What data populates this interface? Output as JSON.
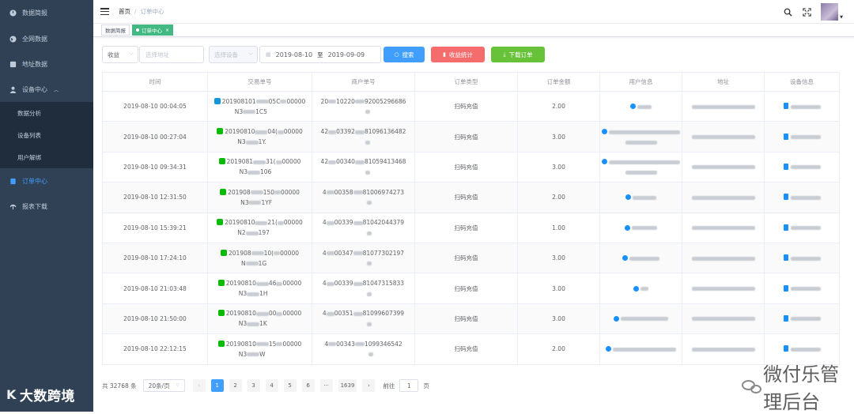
{
  "sidebar": {
    "items": [
      {
        "label": "数据简报",
        "icon": "dashboard-icon"
      },
      {
        "label": "全网数据",
        "icon": "globe-icon"
      },
      {
        "label": "地址数据",
        "icon": "location-icon"
      },
      {
        "label": "设备中心",
        "icon": "user-group-icon"
      },
      {
        "label": "订单中心",
        "icon": "order-icon"
      },
      {
        "label": "报表下载",
        "icon": "download-icon"
      }
    ],
    "sub_items": [
      "数据分析",
      "设备列表",
      "用户解绑"
    ],
    "active_color": "#409eff",
    "background": "#304156"
  },
  "watermark_left": {
    "logo": "K",
    "text": "大数跨境"
  },
  "header": {
    "breadcrumb_home": "首页",
    "breadcrumb_separator": "/",
    "breadcrumb_current": "订单中心"
  },
  "tags": {
    "items": [
      "数据简报",
      "订单中心"
    ],
    "close": "×",
    "active_color": "#42b983"
  },
  "filters": {
    "type_value": "收益",
    "address_placeholder": "选择地址",
    "device_placeholder": "选择设备",
    "date_start": "2019-08-10",
    "date_separator": "至",
    "date_end": "2019-09-09",
    "search_button": "搜索",
    "stats_button": "收益统计",
    "download_button": "下载订单",
    "search_color": "#409eff",
    "stats_color": "#f56c6c",
    "download_color": "#67c23a"
  },
  "table": {
    "columns": [
      "时间",
      "交易单号",
      "商户单号",
      "订单类型",
      "订单金额",
      "用户信息",
      "地址",
      "设备信息"
    ],
    "rows": [
      {
        "time": "2019-08-10 00:04:05",
        "trade_a": "201908101",
        "trade_mid": "05C",
        "trade_tail": "00000",
        "trade_b": "N3",
        "trade_b_tail": "1C5",
        "pay": "alipay",
        "merchant": "20",
        "merchant_mid": "10220",
        "merchant_tail": "92005296686",
        "type": "扫码充值",
        "amount": "2.00"
      },
      {
        "time": "2019-08-10 00:27:04",
        "trade_a": "20190810",
        "trade_mid": "04(",
        "trade_tail": "00000",
        "trade_b": "N3",
        "trade_b_tail": "1Y.",
        "pay": "wechat",
        "merchant": "42",
        "merchant_mid": "03392",
        "merchant_tail": "81096136482",
        "type": "扫码充值",
        "amount": "3.00"
      },
      {
        "time": "2019-08-10 09:34:31",
        "trade_a": "2019081",
        "trade_mid": "31(",
        "trade_tail": "00000",
        "trade_b": "N3",
        "trade_b_tail": "106",
        "pay": "wechat",
        "merchant": "42",
        "merchant_mid": "00340",
        "merchant_tail": "81059413468",
        "type": "扫码充值",
        "amount": "3.00"
      },
      {
        "time": "2019-08-10 12:31:50",
        "trade_a": "201908",
        "trade_mid": "150",
        "trade_tail": "00000",
        "trade_b": "N3",
        "trade_b_tail": "1YF",
        "pay": "wechat",
        "merchant": "4",
        "merchant_mid": "00358",
        "merchant_tail": "81006974273",
        "type": "扫码充值",
        "amount": "2.00"
      },
      {
        "time": "2019-08-10 15:39:21",
        "trade_a": "20190810",
        "trade_mid": "21(",
        "trade_tail": "00000",
        "trade_b": "N2",
        "trade_b_tail": "197",
        "pay": "wechat",
        "merchant": "4",
        "merchant_mid": "00339",
        "merchant_tail": "81042044379",
        "type": "扫码充值",
        "amount": "1.00"
      },
      {
        "time": "2019-08-10 17:24:10",
        "trade_a": "201908",
        "trade_mid": "10(",
        "trade_tail": "00000",
        "trade_b": "N",
        "trade_b_tail": "1G",
        "pay": "wechat",
        "merchant": "4",
        "merchant_mid": "00347",
        "merchant_tail": "81077302197",
        "type": "扫码充值",
        "amount": "3.00"
      },
      {
        "time": "2019-08-10 21:03:48",
        "trade_a": "20190810",
        "trade_mid": "46",
        "trade_tail": "00000",
        "trade_b": "N3",
        "trade_b_tail": "1H",
        "pay": "wechat",
        "merchant": "4",
        "merchant_mid": "00339",
        "merchant_tail": "81047315833",
        "type": "扫码充值",
        "amount": "3.00"
      },
      {
        "time": "2019-08-10 21:50:00",
        "trade_a": "20190810",
        "trade_mid": "00",
        "trade_tail": "00000",
        "trade_b": "N3",
        "trade_b_tail": "1K",
        "pay": "wechat",
        "merchant": "4",
        "merchant_mid": "00351",
        "merchant_tail": "81099607399",
        "type": "扫码充值",
        "amount": "3.00"
      },
      {
        "time": "2019-08-10 22:12:15",
        "trade_a": "20190810",
        "trade_mid": "15",
        "trade_tail": "00000",
        "trade_b": "N3",
        "trade_b_tail": "W",
        "pay": "wechat",
        "merchant": "4",
        "merchant_mid": "00343",
        "merchant_tail": "1099346542",
        "type": "扫码充值",
        "amount": "2.00"
      }
    ]
  },
  "pagination": {
    "total": "共 32768 条",
    "page_size": "20条/页",
    "prev": "‹",
    "pages": [
      "1",
      "2",
      "3",
      "4",
      "5",
      "6",
      "···",
      "1639"
    ],
    "next": "›",
    "goto_label": "前往",
    "goto_value": "1",
    "goto_suffix": "页"
  },
  "watermark_right": {
    "text": "微付乐管理后台"
  }
}
